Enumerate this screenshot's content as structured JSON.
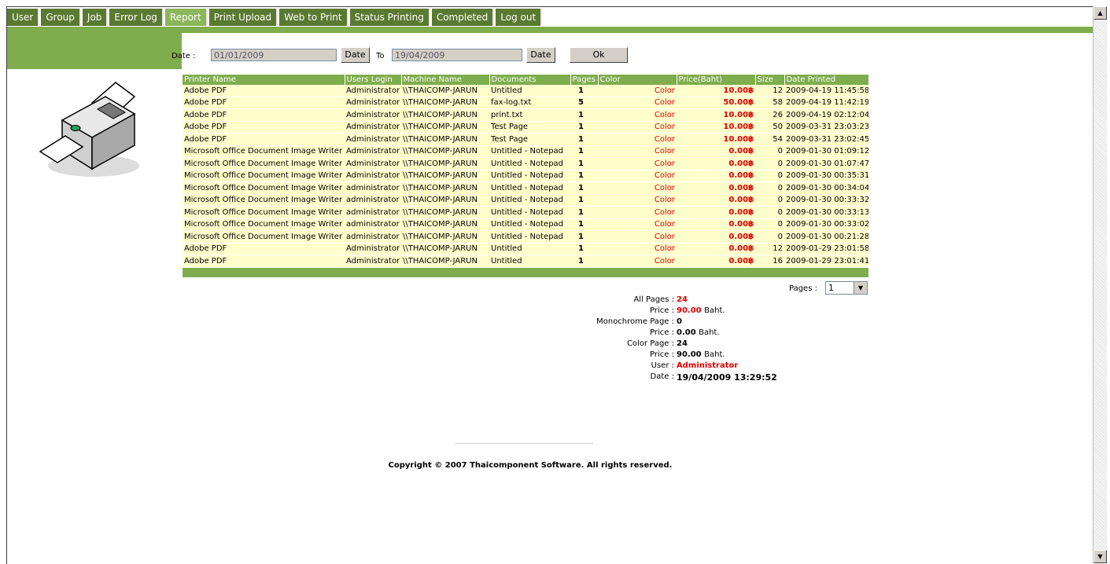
{
  "tabs": [
    "User",
    "Group",
    "Job",
    "Error Log",
    "Report",
    "Print Upload",
    "Web to Print",
    "Status Printing",
    "Completed",
    "Log out"
  ],
  "active_tab": "Report",
  "filter": {
    "date_label": "Date :",
    "from_value": "01/01/2009",
    "date_button": "Date",
    "to_label": "To",
    "to_value": "19/04/2009",
    "ok_button": "Ok"
  },
  "table": {
    "headers": [
      "Printer Name",
      "Users Login",
      "Machine Name",
      "Documents",
      "Pages",
      "Color",
      "Price(Baht)",
      "Size",
      "Date Printed"
    ],
    "rows": [
      [
        "Adobe PDF",
        "Administrator",
        "\\\\THAICOMP-JARUN",
        "Untitled",
        "1",
        "Color",
        "10.00฿",
        "12",
        "2009-04-19 11:45:58"
      ],
      [
        "Adobe PDF",
        "Administrator",
        "\\\\THAICOMP-JARUN",
        "fax-log.txt",
        "5",
        "Color",
        "50.00฿",
        "58",
        "2009-04-19 11:42:19"
      ],
      [
        "Adobe PDF",
        "Administrator",
        "\\\\THAICOMP-JARUN",
        "print.txt",
        "1",
        "Color",
        "10.00฿",
        "26",
        "2009-04-19 02:12:04"
      ],
      [
        "Adobe PDF",
        "Administrator",
        "\\\\THAICOMP-JARUN",
        "Test Page",
        "1",
        "Color",
        "10.00฿",
        "50",
        "2009-03-31 23:03:23"
      ],
      [
        "Adobe PDF",
        "Administrator",
        "\\\\THAICOMP-JARUN",
        "Test Page",
        "1",
        "Color",
        "10.00฿",
        "54",
        "2009-03-31 23:02:45"
      ],
      [
        "Microsoft Office Document Image Writer",
        "Administrator",
        "\\\\THAICOMP-JARUN",
        "Untitled - Notepad",
        "1",
        "Color",
        "0.00฿",
        "0",
        "2009-01-30 01:09:12"
      ],
      [
        "Microsoft Office Document Image Writer",
        "Administrator",
        "\\\\THAICOMP-JARUN",
        "Untitled - Notepad",
        "1",
        "Color",
        "0.00฿",
        "0",
        "2009-01-30 01:07:47"
      ],
      [
        "Microsoft Office Document Image Writer",
        "Administrator",
        "\\\\THAICOMP-JARUN",
        "Untitled - Notepad",
        "1",
        "Color",
        "0.00฿",
        "0",
        "2009-01-30 00:35:31"
      ],
      [
        "Microsoft Office Document Image Writer",
        "administrator",
        "\\\\THAICOMP-JARUN",
        "Untitled - Notepad",
        "1",
        "Color",
        "0.00฿",
        "0",
        "2009-01-30 00:34:04"
      ],
      [
        "Microsoft Office Document Image Writer",
        "administrator",
        "\\\\THAICOMP-JARUN",
        "Untitled - Notepad",
        "1",
        "Color",
        "0.00฿",
        "0",
        "2009-01-30 00:33:32"
      ],
      [
        "Microsoft Office Document Image Writer",
        "administrator",
        "\\\\THAICOMP-JARUN",
        "Untitled - Notepad",
        "1",
        "Color",
        "0.00฿",
        "0",
        "2009-01-30 00:33:13"
      ],
      [
        "Microsoft Office Document Image Writer",
        "administrator",
        "\\\\THAICOMP-JARUN",
        "Untitled - Notepad",
        "1",
        "Color",
        "0.00฿",
        "0",
        "2009-01-30 00:33:02"
      ],
      [
        "Microsoft Office Document Image Writer",
        "administrator",
        "\\\\THAICOMP-JARUN",
        "Untitled - Notepad",
        "1",
        "Color",
        "0.00฿",
        "0",
        "2009-01-30 00:21:28"
      ],
      [
        "Adobe PDF",
        "Administrator",
        "\\\\THAICOMP-JARUN",
        "Untitled",
        "1",
        "Color",
        "0.00฿",
        "12",
        "2009-01-29 23:01:58"
      ],
      [
        "Adobe PDF",
        "Administrator",
        "\\\\THAICOMP-JARUN",
        "Untitled",
        "1",
        "Color",
        "0.00฿",
        "16",
        "2009-01-29 23:01:41"
      ]
    ]
  },
  "pager": {
    "label": "Pages :",
    "selected": "1"
  },
  "summary": {
    "all_pages_label": "All Pages :",
    "all_pages": "24",
    "price1_label": "Price :",
    "price1": "90.00",
    "baht": "Baht.",
    "mono_label": "Monochrome Page :",
    "mono": "0",
    "price2_label": "Price :",
    "price2": "0.00",
    "color_label": "Color Page :",
    "color": "24",
    "price3_label": "Price :",
    "price3": "90.00",
    "user_label": "User :",
    "user": "Administrator",
    "date_label": "Date :",
    "date": "19/04/2009 13:29:52"
  },
  "footer": {
    "copyright": "Copyright © 2007 Thaicomponent Software. All rights reserved."
  },
  "icons": {
    "printer": "printer-icon",
    "scroll_up": "arrow-up-icon",
    "scroll_down": "arrow-down-icon",
    "dropdown": "chevron-down-icon"
  },
  "colors": {
    "tab_bg": "#5a7a32",
    "tab_active": "#8cb55c",
    "green": "#7fad4e",
    "row_bg": "#ffffcc",
    "price_red": "#e00000"
  }
}
